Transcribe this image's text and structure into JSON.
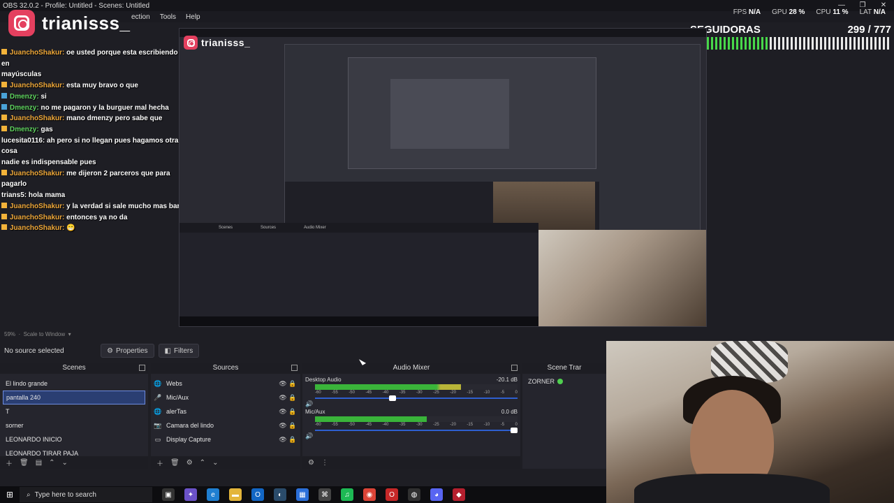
{
  "window": {
    "title": "OBS 32.0.2 - Profile: Untitled - Scenes: Untitled"
  },
  "menu": [
    "ection",
    "Tools",
    "Help"
  ],
  "stats": [
    {
      "label": "FPS",
      "value": "N/A"
    },
    {
      "label": "GPU",
      "value": "28 %"
    },
    {
      "label": "CPU",
      "value": "11 %"
    },
    {
      "label": "LAT",
      "value": "N/A"
    }
  ],
  "overlay": {
    "instagram_handle": "trianisss_",
    "followers_label": "SEGUIDORAS",
    "followers_count": "299 / 777",
    "followers_progress": 0.385
  },
  "chat": [
    {
      "user": "JuanchoShakur:",
      "msg": "oe usted porque esta escribiendo asi en",
      "badge": "gold",
      "color": "orange"
    },
    {
      "user": "",
      "msg": "mayúsculas",
      "badge": "",
      "color": "white"
    },
    {
      "user": "JuanchoShakur:",
      "msg": "esta muy bravo o que",
      "badge": "gold",
      "color": "orange"
    },
    {
      "user": "Dmenzy:",
      "msg": "si",
      "badge": "blue",
      "color": "green"
    },
    {
      "user": "Dmenzy:",
      "msg": "no me pagaron y la burguer mal hecha",
      "badge": "blue",
      "color": "green"
    },
    {
      "user": "JuanchoShakur:",
      "msg": "mano dmenzy pero sabe que",
      "badge": "gold",
      "color": "orange"
    },
    {
      "user": "Dmenzy:",
      "msg": "gas",
      "badge": "gold",
      "color": "green"
    },
    {
      "user": "lucesita0116:",
      "msg": "ah pero si no llegan pues hagamos otra cosa",
      "badge": "",
      "color": "white"
    },
    {
      "user": "",
      "msg": "nadie es indispensable pues",
      "badge": "",
      "color": "white"
    },
    {
      "user": "JuanchoShakur:",
      "msg": "me dijeron 2 parceros que para pagarlo",
      "badge": "gold",
      "color": "orange"
    },
    {
      "user": "trians5:",
      "msg": "hola mama",
      "badge": "",
      "color": "white"
    },
    {
      "user": "JuanchoShakur:",
      "msg": "y la verdad si sale mucho mas barato",
      "badge": "gold",
      "color": "orange"
    },
    {
      "user": "JuanchoShakur:",
      "msg": "entonces ya no da",
      "badge": "gold",
      "color": "orange"
    },
    {
      "user": "JuanchoShakur:",
      "msg": "😁",
      "badge": "gold",
      "color": "orange"
    }
  ],
  "zoom": {
    "label": "59%",
    "mode": "Scale to Window"
  },
  "source_bar": {
    "no_source": "No source selected",
    "properties": "Properties",
    "filters": "Filters"
  },
  "docks": {
    "scenes_title": "Scenes",
    "sources_title": "Sources",
    "mixer_title": "Audio Mixer",
    "transitions_title": "Scene Trar"
  },
  "scenes": [
    "El lindo grande",
    "pantalla 240",
    "T",
    "sorner",
    "LEONARDO INICIO",
    "LEONARDO TIRAR PAJA"
  ],
  "selected_scene": 1,
  "sources": [
    {
      "name": "Webs",
      "icon": "globe-icon"
    },
    {
      "name": "Mic/Aux",
      "icon": "mic-icon"
    },
    {
      "name": "alerTas",
      "icon": "globe-icon"
    },
    {
      "name": "Camara del lindo",
      "icon": "camera-icon"
    },
    {
      "name": "Display Capture",
      "icon": "monitor-icon"
    }
  ],
  "mixer": [
    {
      "name": "Desktop Audio",
      "db": "-20.1 dB",
      "level": 0.72,
      "volume": 0.4
    },
    {
      "name": "Mic/Aux",
      "db": "0.0 dB",
      "level": 0.55,
      "volume": 1.0
    }
  ],
  "meter_scale": [
    "-60",
    "-55",
    "-50",
    "-45",
    "-40",
    "-35",
    "-30",
    "-25",
    "-20",
    "-15",
    "-10",
    "-5",
    "0"
  ],
  "transitions": {
    "item": "ZORNER"
  },
  "taskbar": {
    "search": "Type here to search"
  },
  "colors": {
    "accent": "#2a3e72",
    "meter_green": "#3cc43c",
    "meter_yellow": "#c9c43a",
    "meter_red": "#c24a3a",
    "instagram": "#e4405f"
  }
}
